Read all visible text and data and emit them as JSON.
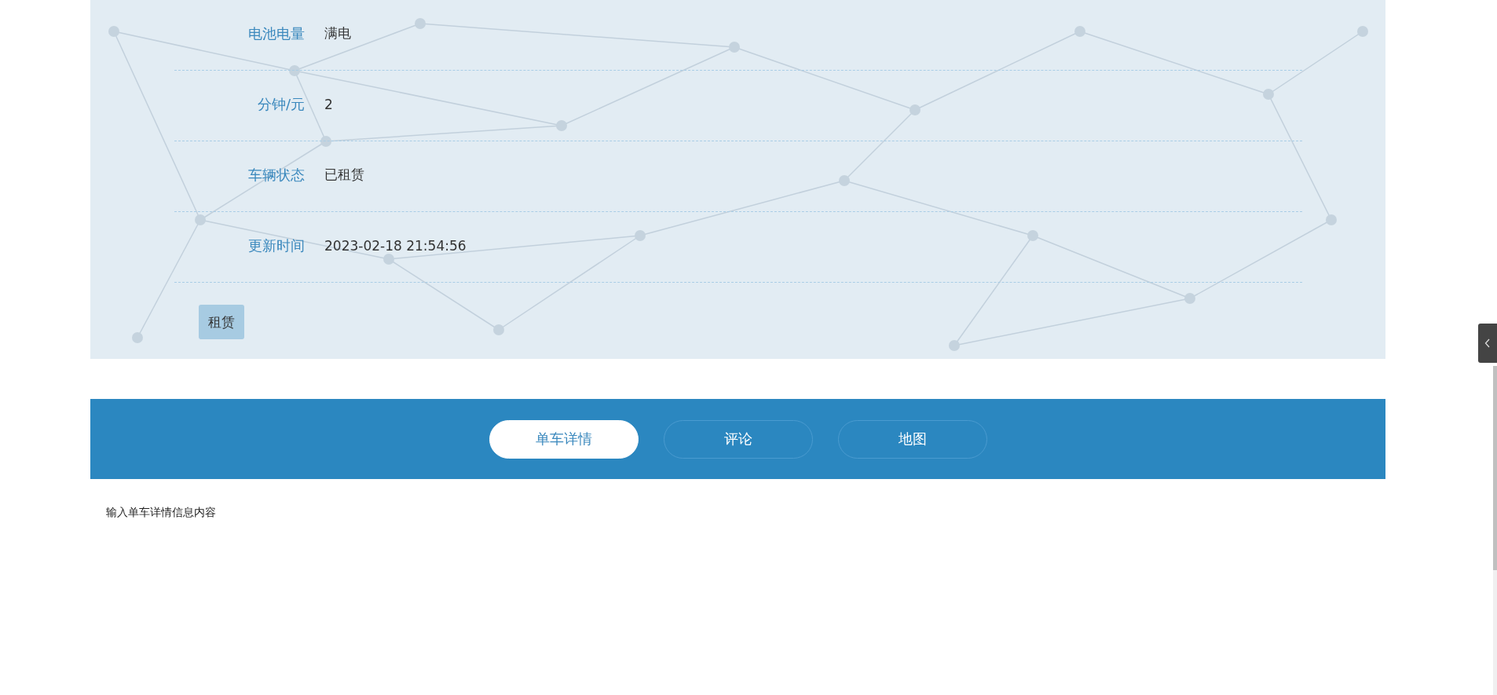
{
  "details": [
    {
      "label": "电池电量",
      "value": "满电"
    },
    {
      "label": "分钟/元",
      "value": "2"
    },
    {
      "label": "车辆状态",
      "value": "已租赁"
    },
    {
      "label": "更新时间",
      "value": "2023-02-18 21:54:56"
    }
  ],
  "rent_button": "租赁",
  "tabs": [
    {
      "label": "单车详情",
      "selected": true
    },
    {
      "label": "评论",
      "selected": false
    },
    {
      "label": "地图",
      "selected": false
    }
  ],
  "tab_content": "输入单车详情信息内容"
}
